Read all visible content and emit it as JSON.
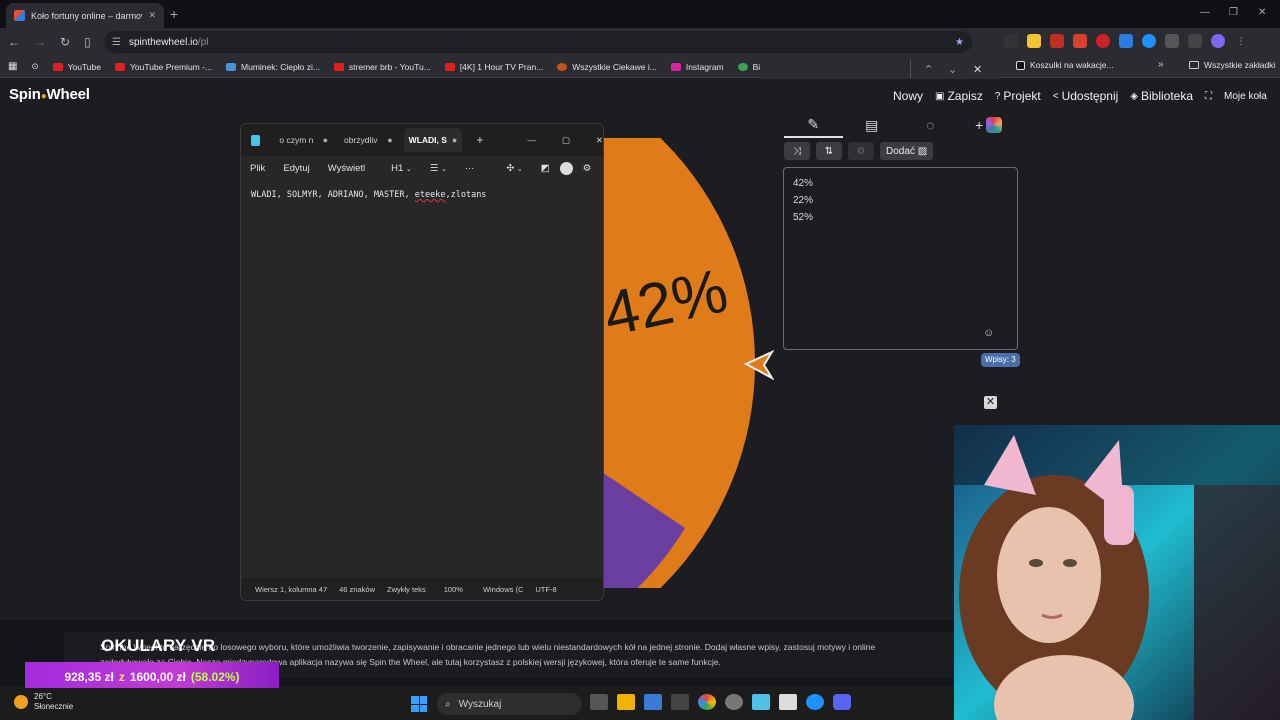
{
  "browser": {
    "tab_title": "Koło fortuny online – darmowe",
    "address": "spinthewheel.io",
    "address_path": "/pl",
    "new_tab_symbol": "+",
    "window_controls": [
      "—",
      "❐",
      "✕"
    ]
  },
  "bookmarks": [
    {
      "label": "YouTube",
      "icon": "youtube-icon"
    },
    {
      "label": "YouTube Premium -...",
      "icon": "youtube-icon"
    },
    {
      "label": "Muminek: Ciepło zi...",
      "icon": "bookmark-icon"
    },
    {
      "label": "stremer brb - YouTu...",
      "icon": "youtube-icon"
    },
    {
      "label": "[4K] 1 Hour TV Pran...",
      "icon": "youtube-icon"
    },
    {
      "label": "Wszystkie Ciekawe i...",
      "icon": "bookmark-icon"
    },
    {
      "label": "Instagram",
      "icon": "instagram-icon"
    },
    {
      "label": "Bilety na l",
      "icon": "bookmark-icon"
    },
    {
      "label": "Koszulki na wakacje...",
      "icon": "tiktok-icon"
    },
    {
      "label": "Wszystkie zakładki",
      "icon": "folder-icon"
    }
  ],
  "site": {
    "logo_left": "Spin",
    "logo_right": "Wheel",
    "nav": [
      {
        "label": "Nowy",
        "icon": ""
      },
      {
        "label": "Zapisz",
        "icon": "save-icon"
      },
      {
        "label": "Projekt",
        "icon": "brush-icon"
      },
      {
        "label": "Udostępnij",
        "icon": "share-icon"
      },
      {
        "label": "Biblioteka",
        "icon": "library-icon"
      },
      {
        "label": "Moje koła",
        "icon": "fullscreen-icon"
      }
    ]
  },
  "wheel": {
    "slice_label": "42%",
    "colors": {
      "orange": "#e07b1a",
      "purple": "#6b3fa0"
    }
  },
  "editor": {
    "add_label": "Dodać",
    "entries": [
      "42%",
      "22%",
      "52%"
    ],
    "count_label": "Wpisy: 3"
  },
  "notepad": {
    "tabs": [
      "o czym n",
      "obrzydliv",
      "WLADI, S"
    ],
    "menu": [
      "Plik",
      "Edytuj",
      "Wyświetl"
    ],
    "heading": "H1",
    "text_plain": "WLADI, SOLMYR, ADRIANO, MASTER, ",
    "text_spell": "eteeke",
    "text_tail": ",zlotans",
    "status": [
      "Wiersz 1, kolumna 47",
      "46 znaków",
      "Zwykły teks",
      "100%",
      "Windows (C",
      "UTF-8"
    ]
  },
  "footer": {
    "text": "Spin the Wheel to narzędzie do losowego wyboru, które umożliwia tworzenie, zapisywanie i obracanie jednego lub wielu niestandardowych kół na jednej stronie. Dodaj własne wpisy, zastosuj motywy i online zadedykowało za Ciebie. Nasza międzynarodowa aplikacja nazywa się Spin the Wheel, ale tutaj korzystasz z polskiej wersji językowej, która oferuje te same funkcje.",
    "overlay_title": "OKULARY VR",
    "donation_amount": "928,35 zł",
    "donation_sep": "z",
    "donation_goal": "1600,00 zł",
    "donation_pct": "(58.02%)"
  },
  "taskbar": {
    "temperature": "26°C",
    "weather": "Słonecznie",
    "search_placeholder": "Wyszukaj"
  }
}
